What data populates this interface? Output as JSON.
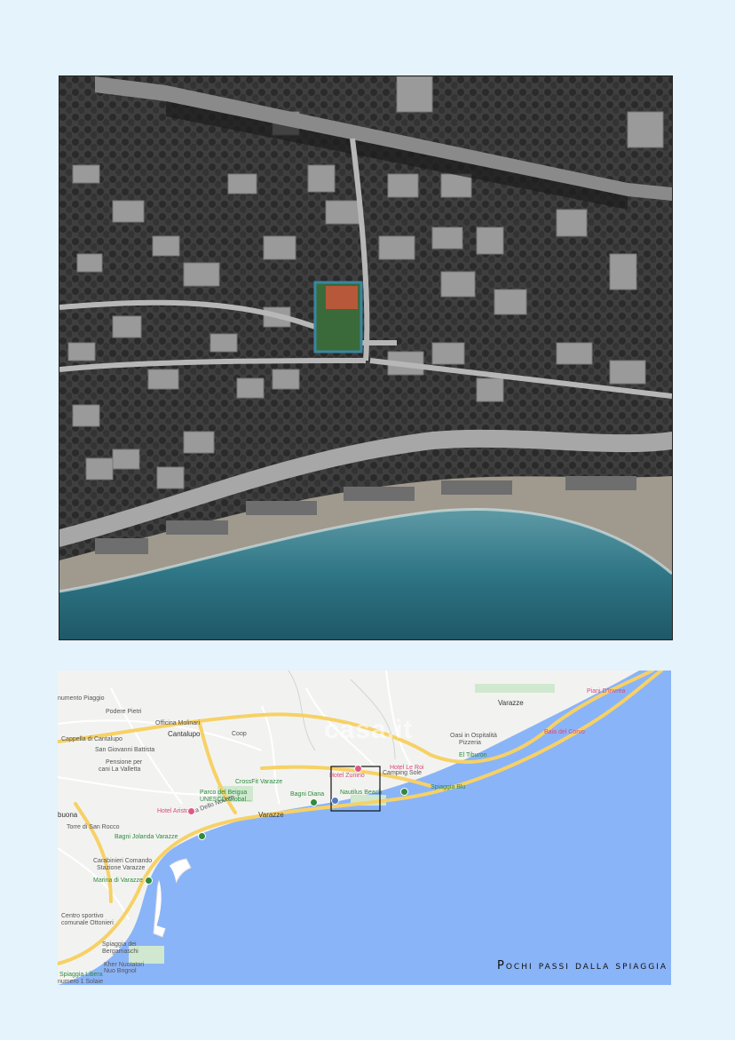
{
  "aerial_photo": {
    "description_icon": "aerial-photo"
  },
  "map": {
    "caption": "Pochi passi dalla spiaggia",
    "watermark": "casa.it",
    "colors": {
      "sea": "#8ab4f8",
      "land": "#f2f3f1",
      "road_major": "#f7d166",
      "road_minor": "#ffffff"
    },
    "labels": {
      "monumento": "numento Piaggio",
      "podere": "Podere Pietri",
      "officina": "Officina Molinari",
      "cappella": "Cappella di Cantalupo",
      "cantalupo": "Cantalupo",
      "coop": "Coop",
      "sangiovanni": "San Giovanni Battista",
      "pensione": "Pensione per",
      "lavalletta": "cani La Valletta",
      "crossfit": "CrossFit Varazze",
      "camping": "Camping Sole",
      "hotelzunino": "Hotel Zunino",
      "hotelleroi": "Hotel Le Roi",
      "parco": "Parco del Beigua",
      "unesco": "UNESCO Global...",
      "bagnidiana": "Bagni Diana",
      "nautilus": "Nautilus Beach",
      "spiaggia_blu": "Spiaggia Blu",
      "hotelariston": "Hotel Ariston",
      "viadelnoceto": "Via Dello Noceto",
      "varazze": "Varazze",
      "buona": "buona",
      "torre": "Torre di San Rocco",
      "bagnijolanda": "Bagni Jolanda Varazze",
      "carabinieri": "Carabinieri Comando",
      "stazione": "Stazione Varazze",
      "marina": "Marina di Varazze",
      "centro": "Centro sportivo",
      "ottonieri": "comunale Ottonieri",
      "bergamasco": "Spiaggia dei",
      "bergamasco2": "Bergamaschi",
      "kher": "Kher Nuotatori",
      "piscina": "Nuo Brignol",
      "spiaggialibera": "Spiaggia Libera",
      "numero": "numero 1 Solaie",
      "varazze_top": "Varazze",
      "oasi": "Oasi in Ospitalità",
      "piani": "Piani D'Invrea",
      "baia": "Baia del Corvo",
      "pizzeria": "Pizzeria",
      "eltiburon": "El Tiburon"
    }
  }
}
